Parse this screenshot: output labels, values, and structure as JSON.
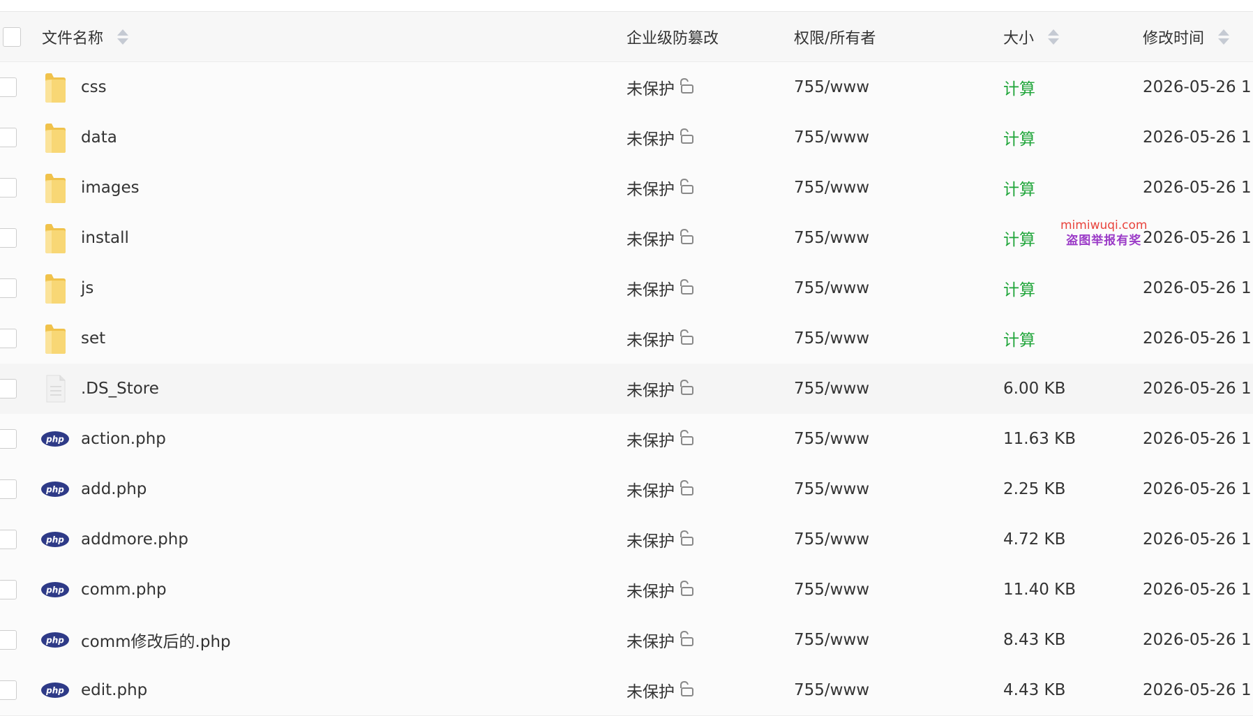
{
  "header": {
    "name": "文件名称",
    "protection": "企业级防篡改",
    "permission": "权限/所有者",
    "size": "大小",
    "modified": "修改时间"
  },
  "rows": [
    {
      "type": "folder",
      "name": "css",
      "protection": "未保护",
      "permission": "755/www",
      "size": "计算",
      "modified": "2026-05-26 1"
    },
    {
      "type": "folder",
      "name": "data",
      "protection": "未保护",
      "permission": "755/www",
      "size": "计算",
      "modified": "2026-05-26 1"
    },
    {
      "type": "folder",
      "name": "images",
      "protection": "未保护",
      "permission": "755/www",
      "size": "计算",
      "modified": "2026-05-26 1"
    },
    {
      "type": "folder",
      "name": "install",
      "protection": "未保护",
      "permission": "755/www",
      "size": "计算",
      "modified": "2026-05-26 1"
    },
    {
      "type": "folder",
      "name": "js",
      "protection": "未保护",
      "permission": "755/www",
      "size": "计算",
      "modified": "2026-05-26 1"
    },
    {
      "type": "folder",
      "name": "set",
      "protection": "未保护",
      "permission": "755/www",
      "size": "计算",
      "modified": "2026-05-26 1"
    },
    {
      "type": "file",
      "name": ".DS_Store",
      "protection": "未保护",
      "permission": "755/www",
      "size": "6.00 KB",
      "modified": "2026-05-26 1"
    },
    {
      "type": "php",
      "name": "action.php",
      "protection": "未保护",
      "permission": "755/www",
      "size": "11.63 KB",
      "modified": "2026-05-26 1"
    },
    {
      "type": "php",
      "name": "add.php",
      "protection": "未保护",
      "permission": "755/www",
      "size": "2.25 KB",
      "modified": "2026-05-26 1"
    },
    {
      "type": "php",
      "name": "addmore.php",
      "protection": "未保护",
      "permission": "755/www",
      "size": "4.72 KB",
      "modified": "2026-05-26 1"
    },
    {
      "type": "php",
      "name": "comm.php",
      "protection": "未保护",
      "permission": "755/www",
      "size": "11.40 KB",
      "modified": "2026-05-26 1"
    },
    {
      "type": "php",
      "name": "comm修改后的.php",
      "protection": "未保护",
      "permission": "755/www",
      "size": "8.43 KB",
      "modified": "2026-05-26 1"
    },
    {
      "type": "php",
      "name": "edit.php",
      "protection": "未保护",
      "permission": "755/www",
      "size": "4.43 KB",
      "modified": "2026-05-26 1"
    }
  ],
  "php_badge": "php",
  "watermark": {
    "line1": "mimiwuqi.com",
    "line2": "盗图举报有奖"
  },
  "colors": {
    "calc_link": "#20a53a",
    "folder": "#f8d775",
    "php_badge": "#2e3a87"
  }
}
